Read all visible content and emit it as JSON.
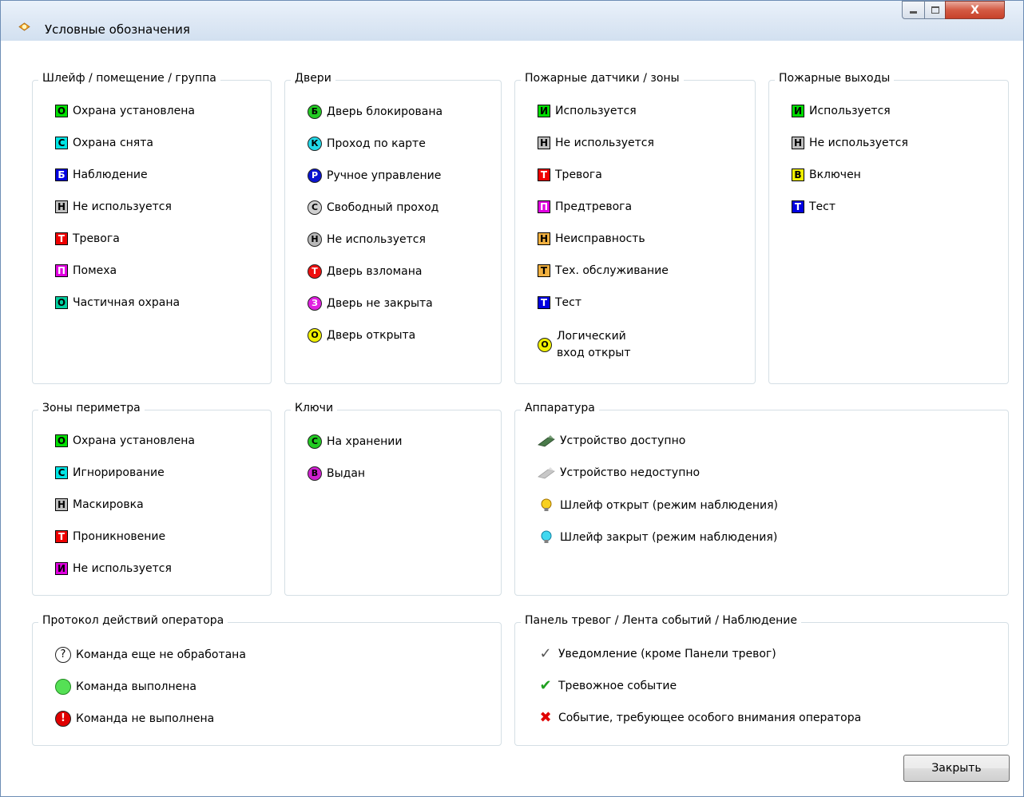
{
  "window": {
    "title": "Условные обозначения",
    "close_glyph": "X"
  },
  "groups": {
    "loop": {
      "title": "Шлейф / помещение / группа",
      "items": [
        {
          "badge": "О",
          "label": "Охрана установлена",
          "bg": "#00e000",
          "fg": "#000000"
        },
        {
          "badge": "С",
          "label": "Охрана снята",
          "bg": "#00e5e5",
          "fg": "#000000"
        },
        {
          "badge": "Б",
          "label": "Наблюдение",
          "bg": "#0000e0",
          "fg": "#ffffff"
        },
        {
          "badge": "Н",
          "label": "Не используется",
          "bg": "#c0c0c0",
          "fg": "#000000"
        },
        {
          "badge": "Т",
          "label": "Тревога",
          "bg": "#ee0000",
          "fg": "#ffffff"
        },
        {
          "badge": "П",
          "label": "Помеха",
          "bg": "#e000e0",
          "fg": "#ffffff"
        },
        {
          "badge": "О",
          "label": "Частичная охрана",
          "bg": "#00d0a0",
          "fg": "#000000"
        }
      ]
    },
    "doors": {
      "title": "Двери",
      "items": [
        {
          "badge": "Б",
          "label": "Дверь блокирована",
          "bg": "#22cc22",
          "fg": "#000000"
        },
        {
          "badge": "К",
          "label": "Проход по карте",
          "bg": "#22d8e8",
          "fg": "#000000"
        },
        {
          "badge": "Р",
          "label": "Ручное управление",
          "bg": "#0a14d0",
          "fg": "#ffffff"
        },
        {
          "badge": "С",
          "label": "Свободный проход",
          "bg": "#d0d0d0",
          "fg": "#000000"
        },
        {
          "badge": "Н",
          "label": "Не используется",
          "bg": "#b8b8b8",
          "fg": "#000000"
        },
        {
          "badge": "Т",
          "label": "Дверь взломана",
          "bg": "#ee1010",
          "fg": "#ffffff"
        },
        {
          "badge": "З",
          "label": "Дверь не закрыта",
          "bg": "#e020e0",
          "fg": "#ffffff"
        },
        {
          "badge": "О",
          "label": "Дверь открыта",
          "bg": "#f0f000",
          "fg": "#000000"
        }
      ]
    },
    "fire_sensors": {
      "title": "Пожарные датчики / зоны",
      "items": [
        {
          "badge": "И",
          "label": "Используется",
          "bg": "#00dd00",
          "fg": "#000000"
        },
        {
          "badge": "Н",
          "label": "Не используется",
          "bg": "#c0c0c0",
          "fg": "#000000"
        },
        {
          "badge": "Т",
          "label": "Тревога",
          "bg": "#ee0000",
          "fg": "#ffffff"
        },
        {
          "badge": "П",
          "label": "Предтревога",
          "bg": "#e000e0",
          "fg": "#ffffff"
        },
        {
          "badge": "Н",
          "label": "Неисправность",
          "bg": "#f0b040",
          "fg": "#000000"
        },
        {
          "badge": "Т",
          "label": "Тех. обслуживание",
          "bg": "#f0b040",
          "fg": "#000000"
        },
        {
          "badge": "Т",
          "label": "Тест",
          "bg": "#0000e0",
          "fg": "#ffffff"
        }
      ],
      "logic": {
        "badge": "О",
        "line1": "Логический",
        "line2": "вход открыт",
        "bg": "#f0f000"
      }
    },
    "fire_exits": {
      "title": "Пожарные выходы",
      "items": [
        {
          "badge": "И",
          "label": "Используется",
          "bg": "#00dd00",
          "fg": "#000000"
        },
        {
          "badge": "Н",
          "label": "Не используется",
          "bg": "#c0c0c0",
          "fg": "#000000"
        },
        {
          "badge": "В",
          "label": "Включен",
          "bg": "#f0f000",
          "fg": "#000000"
        },
        {
          "badge": "Т",
          "label": "Тест",
          "bg": "#0000e0",
          "fg": "#ffffff"
        }
      ]
    },
    "perimeter": {
      "title": "Зоны периметра",
      "items": [
        {
          "badge": "О",
          "label": "Охрана установлена",
          "bg": "#00e000",
          "fg": "#000000"
        },
        {
          "badge": "С",
          "label": "Игнорирование",
          "bg": "#00e5e5",
          "fg": "#000000"
        },
        {
          "badge": "Н",
          "label": "Маскировка",
          "bg": "#c0c0c0",
          "fg": "#000000"
        },
        {
          "badge": "Т",
          "label": "Проникновение",
          "bg": "#ee0000",
          "fg": "#ffffff"
        },
        {
          "badge": "И",
          "label": "Не используется",
          "bg": "#e000e0",
          "fg": "#000000"
        }
      ]
    },
    "keys": {
      "title": "Ключи",
      "items": [
        {
          "badge": "С",
          "label": "На хранении",
          "bg": "#22cc22",
          "fg": "#000000"
        },
        {
          "badge": "В",
          "label": "Выдан",
          "bg": "#d020d0",
          "fg": "#000000"
        }
      ]
    },
    "hardware": {
      "title": "Аппаратура",
      "items": [
        {
          "icon": "device-available-icon",
          "label": "Устройство доступно"
        },
        {
          "icon": "device-unavailable-icon",
          "label": "Устройство недоступно"
        },
        {
          "icon": "bulb-yellow-icon",
          "label": "Шлейф открыт (режим наблюдения)"
        },
        {
          "icon": "bulb-cyan-icon",
          "label": "Шлейф закрыт (режим наблюдения)"
        }
      ]
    },
    "operator_log": {
      "title": "Протокол действий оператора",
      "items": [
        {
          "icon": "question-icon",
          "glyph": "?",
          "label": "Команда еще не обработана"
        },
        {
          "icon": "green-circle-icon",
          "glyph": "",
          "label": "Команда выполнена"
        },
        {
          "icon": "exclamation-icon",
          "glyph": "!",
          "label": "Команда не выполнена"
        }
      ]
    },
    "alarm_panel": {
      "title": "Панель тревог / Лента событий / Наблюдение",
      "items": [
        {
          "icon": "checkmark-outline-icon",
          "glyph": "✓",
          "label": "Уведомление (кроме Панели тревог)"
        },
        {
          "icon": "checkmark-green-icon",
          "glyph": "✔",
          "label": "Тревожное событие"
        },
        {
          "icon": "red-cross-icon",
          "glyph": "✖",
          "label": "Событие, требующее особого внимания оператора"
        }
      ]
    }
  },
  "buttons": {
    "close": "Закрыть"
  }
}
